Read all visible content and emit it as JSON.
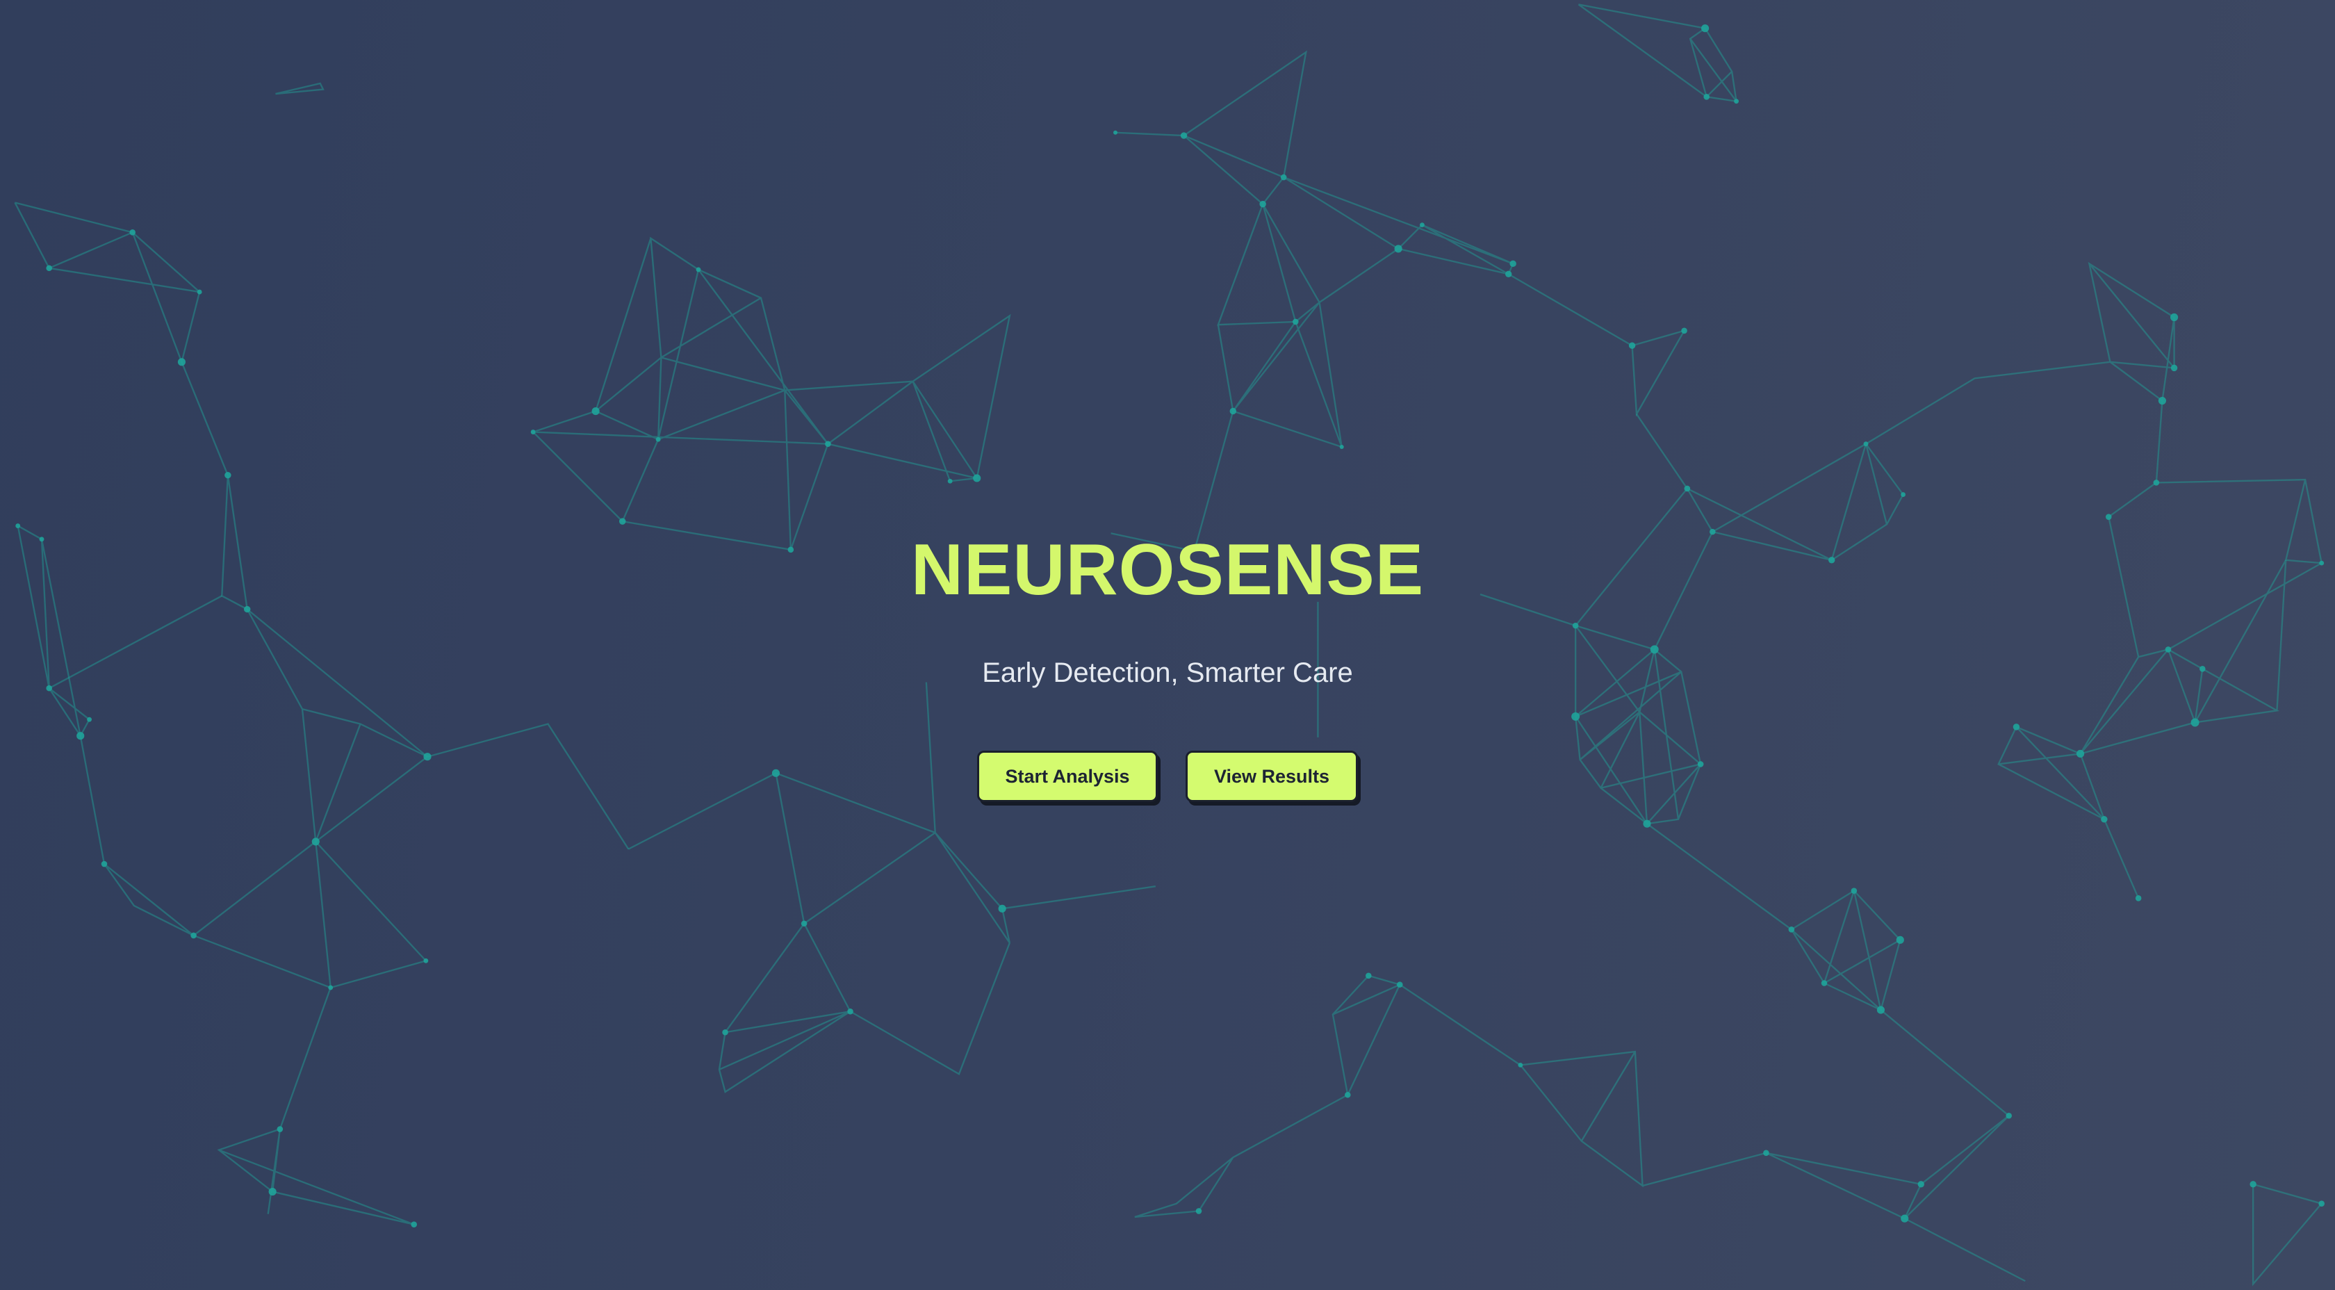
{
  "hero": {
    "title": "NEUROSENSE",
    "subtitle": "Early Detection, Smarter Care"
  },
  "actions": {
    "start_label": "Start Analysis",
    "view_label": "View Results"
  },
  "colors": {
    "background": "#36425f",
    "accent": "#d4f76c",
    "network": "#1fa39a"
  }
}
